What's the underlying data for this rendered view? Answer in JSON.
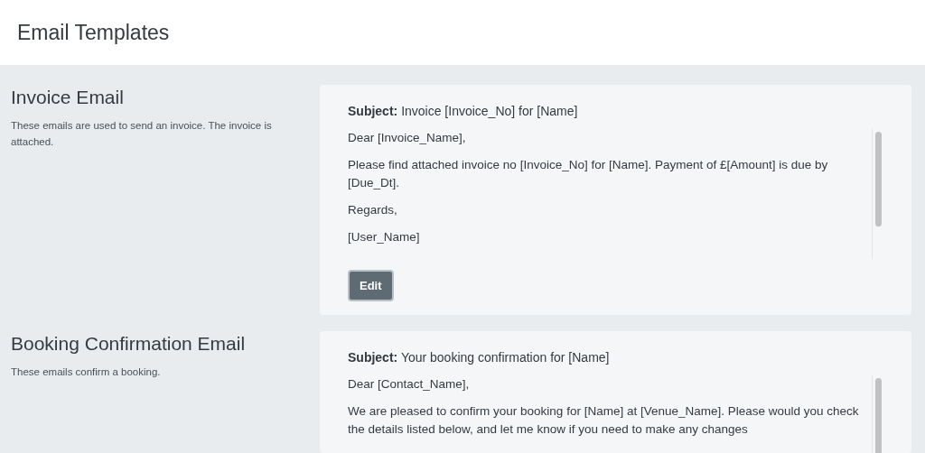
{
  "page": {
    "title": "Email Templates"
  },
  "templates": [
    {
      "title": "Invoice Email",
      "description": "These emails are used to send an invoice. The invoice is attached.",
      "subject_label": "Subject:",
      "subject": "Invoice [Invoice_No] for [Name]",
      "body": [
        "Dear [Invoice_Name],",
        "Please find attached invoice no [Invoice_No] for [Name].  Payment of £[Amount] is due by [Due_Dt].",
        "Regards,",
        "[User_Name]"
      ],
      "button": "Edit"
    },
    {
      "title": "Booking Confirmation Email",
      "description": "These emails confirm a booking.",
      "subject_label": "Subject:",
      "subject": "Your booking confirmation for [Name]",
      "body": [
        "Dear [Contact_Name],",
        "We are pleased to confirm your booking for [Name] at [Venue_Name]. Please would you check the details listed below, and let me know if you need to make any changes"
      ]
    }
  ]
}
